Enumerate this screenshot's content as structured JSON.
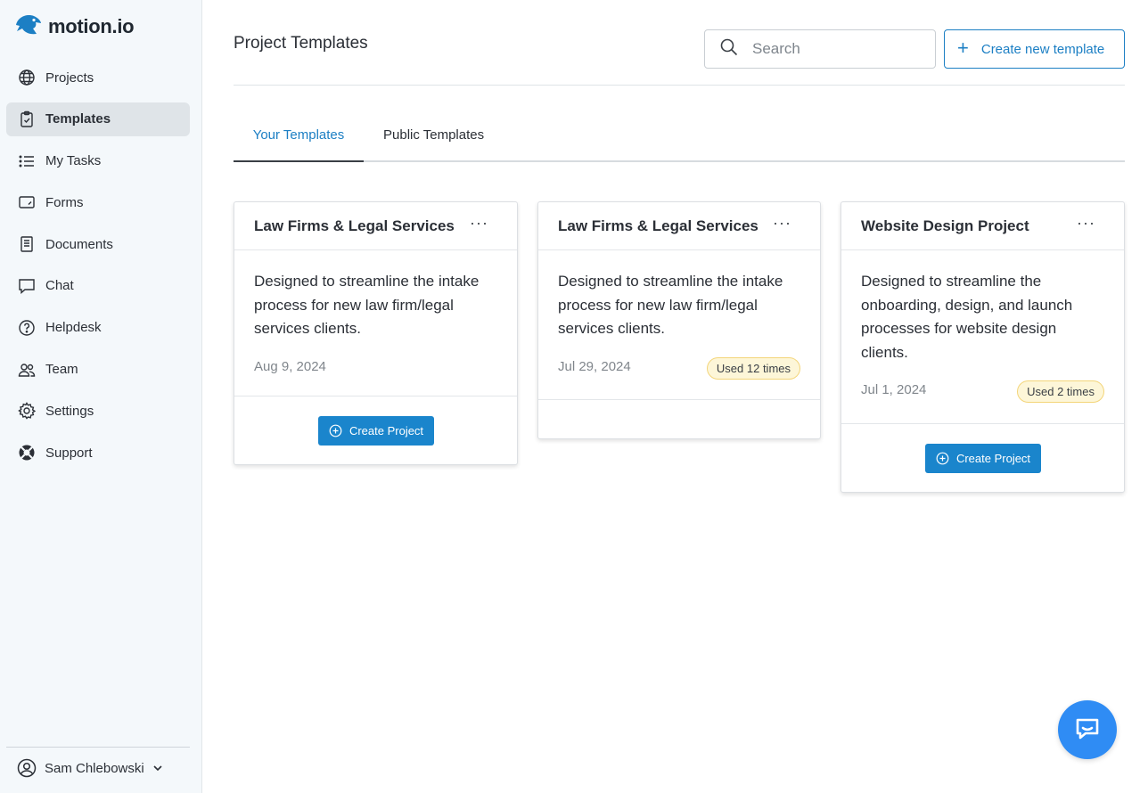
{
  "app": {
    "logo_text": "motion.io"
  },
  "sidebar": {
    "items": [
      {
        "label": "Projects",
        "icon": "globe-icon",
        "active": false
      },
      {
        "label": "Templates",
        "icon": "clipboard-check-icon",
        "active": true
      },
      {
        "label": "My Tasks",
        "icon": "list-icon",
        "active": false
      },
      {
        "label": "Forms",
        "icon": "form-icon",
        "active": false
      },
      {
        "label": "Documents",
        "icon": "document-icon",
        "active": false
      },
      {
        "label": "Chat",
        "icon": "chat-icon",
        "active": false
      },
      {
        "label": "Helpdesk",
        "icon": "help-circle-icon",
        "active": false
      },
      {
        "label": "Team",
        "icon": "team-icon",
        "active": false
      },
      {
        "label": "Settings",
        "icon": "gear-icon",
        "active": false
      },
      {
        "label": "Support",
        "icon": "lifebuoy-icon",
        "active": false
      }
    ],
    "user": {
      "name": "Sam Chlebowski"
    }
  },
  "header": {
    "title": "Project Templates",
    "search_placeholder": "Search",
    "create_label": "Create new template"
  },
  "tabs": [
    {
      "label": "Your Templates",
      "active": true
    },
    {
      "label": "Public Templates",
      "active": false
    }
  ],
  "cards": [
    {
      "title": "Law Firms & Legal Services",
      "desc_lines": [
        "Designed to streamline the intake",
        "process for new law firm/legal",
        "services clients."
      ],
      "date": "Aug 9, 2024",
      "badge": "",
      "button": "Create Project"
    },
    {
      "title": "Law Firms & Legal Services",
      "desc_lines": [
        "Designed to streamline the intake",
        "process for new law firm/legal",
        "services clients."
      ],
      "date": "Jul 29, 2024",
      "badge": "Used 12 times",
      "button": ""
    },
    {
      "title": "Website Design Project",
      "desc_lines": [
        "Designed to streamline the",
        "onboarding, design, and launch",
        "processes for website design",
        "clients."
      ],
      "date": "Jul 1, 2024",
      "badge": "Used 2 times",
      "button": "Create Project"
    }
  ],
  "colors": {
    "accent": "#1c7fc4",
    "button": "#1a85cc",
    "badge_bg": "#fdf6d8",
    "fab": "#2f8cf4"
  }
}
